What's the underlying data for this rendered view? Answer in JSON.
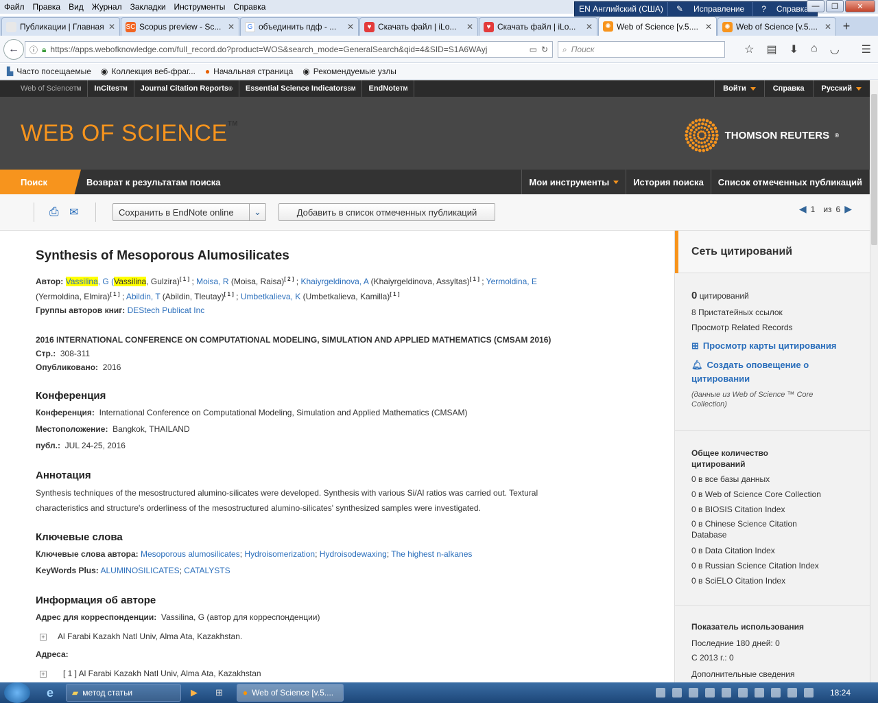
{
  "menubar": [
    "Файл",
    "Правка",
    "Вид",
    "Журнал",
    "Закладки",
    "Инструменты",
    "Справка"
  ],
  "lang_tray": {
    "lang": "EN Английский (США)",
    "correction": "Исправление",
    "help": "Справка"
  },
  "tabs": [
    {
      "label": "Публикации | Главная",
      "color": "#e8e8e8"
    },
    {
      "label": "Scopus preview - Sc...",
      "color": "#f26522",
      "glyph": "SC"
    },
    {
      "label": "объединить пдф - ...",
      "color": "#ffffff",
      "glyph": "G"
    },
    {
      "label": "Скачать файл | iLo...",
      "color": "#e33b3b",
      "glyph": "♥"
    },
    {
      "label": "Скачать файл | iLo...",
      "color": "#e33b3b",
      "glyph": "♥"
    },
    {
      "label": "Web of Science [v.5....",
      "color": "#f7941d",
      "glyph": "✺",
      "active": true
    },
    {
      "label": "Web of Science [v.5....",
      "color": "#f7941d",
      "glyph": "✺"
    }
  ],
  "url": "https://apps.webofknowledge.com/full_record.do?product=WOS&search_mode=GeneralSearch&qid=4&SID=S1A6WAyj",
  "search_placeholder": "Поиск",
  "bookmarks": [
    "Часто посещаемые",
    "Коллекция веб-фраг...",
    "Начальная страница",
    "Рекомендуемые узлы"
  ],
  "wos_top": {
    "wos": "Web of Science",
    "incites": "InCites",
    "jcr": "Journal Citation Reports",
    "esi": "Essential Science Indicators",
    "endnote": "EndNote",
    "login": "Войти",
    "help": "Справка",
    "lang": "Русский"
  },
  "logo": {
    "text": "WEB OF SCIENCE",
    "tr": "THOMSON REUTERS"
  },
  "nav": {
    "search": "Поиск",
    "back": "Возврат к результатам поиска",
    "tools": "Мои инструменты",
    "history": "История поиска",
    "marked": "Список отмеченных публикаций"
  },
  "toolbar": {
    "save": "Сохранить в EndNote online",
    "add": "Добавить в список отмеченных публикаций",
    "page": "1",
    "of": "из",
    "total": "6"
  },
  "record": {
    "title": "Synthesis of Mesoporous Alumosilicates",
    "author_label": "Автор:",
    "authors_line1_pre": "Vassilina",
    "a1_short": ", G (",
    "a1_hl": "Vassilina",
    "a1_rest": ", Gulzira)",
    "a1_ref": "[ 1 ]",
    "a2": "Moisa, R",
    "a2_full": "(Moisa, Raisa)",
    "a2_ref": "[ 2 ]",
    "a3": "Khaiyrgeldinova, A",
    "a3_full": "(Khaiyrgeldinova, Assyltas)",
    "a3_ref": "[ 1 ]",
    "a4": "Yermoldina, E",
    "a4_full": "(Yermoldina, Elmira)",
    "a4_ref": "[ 1 ]",
    "a5": "Abildin, T",
    "a5_full": "(Abildin, Tleutay)",
    "a5_ref": "[ 1 ]",
    "a6": "Umbetkalieva, K",
    "a6_full": "(Umbetkalieva, Kamilla)",
    "a6_ref": "[ 1 ]",
    "group_label": "Группы авторов книг:",
    "group": "DEStech Publicat Inc",
    "source": "2016 INTERNATIONAL CONFERENCE ON COMPUTATIONAL MODELING, SIMULATION AND APPLIED MATHEMATICS (CMSAM 2016)",
    "pages_label": "Стр.:",
    "pages": "308-311",
    "pub_label": "Опубликовано:",
    "pub": "2016",
    "conf_h": "Конференция",
    "conf_label": "Конференция:",
    "conf": "International Conference on Computational Modeling, Simulation and Applied Mathematics (CMSAM)",
    "loc_label": "Местоположение:",
    "loc": "Bangkok, THAILAND",
    "date_label": "публ.:",
    "date": "JUL 24-25, 2016",
    "abs_h": "Аннотация",
    "abs1": "Synthesis techniques of the mesostructured alumino-silicates were developed. Synthesis with various Si/Al ratios was carried out. Textural",
    "abs2": "characteristics and structure's orderliness of the mesostructured alumino-silicates' synthesized samples were investigated.",
    "kw_h": "Ключевые слова",
    "kw_label": "Ключевые слова автора:",
    "kw1": "Mesoporous alumosilicates",
    "kw2": "Hydroisomerization",
    "kw3": "Hydroisodewaxing",
    "kw4": "The highest n-alkanes",
    "kwp_label": "KeyWords Plus:",
    "kwp1": "ALUMINOSILICATES",
    "kwp2": "CATALYSTS",
    "ai_h": "Информация об авторе",
    "corr_label": "Адрес для корреспонденции:",
    "corr": "Vassilina, G (автор для корреспонденции)",
    "corr_addr": "Al Farabi Kazakh Natl Univ, Alma Ata, Kazakhstan.",
    "addr_label": "Адреса:",
    "addr1": "[ 1 ] Al Farabi Kazakh Natl Univ, Alma Ata, Kazakhstan"
  },
  "sidebar": {
    "net_h": "Сеть цитирований",
    "cit_count": "0",
    "cit_label": "цитирований",
    "refs": "8 Пристатейных ссылок",
    "related": "Просмотр Related Records",
    "map": "Просмотр карты цитирования",
    "alert1": "Создать оповещение о",
    "alert2": "цитировании",
    "note1": "(данные из Web of Science ™ Core",
    "note2": "Collection)",
    "total_h1": "Общее количество",
    "total_h2": "цитирований",
    "t1": "0 в все базы данных",
    "t2": "0 в Web of Science Core Collection",
    "t3": "0 в BIOSIS Citation Index",
    "t4a": "0 в Chinese Science Citation",
    "t4b": "Database",
    "t5": "0 в Data Citation Index",
    "t6": "0 в Russian Science Citation Index",
    "t7": "0 в SciELO Citation Index",
    "usage_h": "Показатель использования",
    "u1": "Последние 180 дней: 0",
    "u2": "С 2013 г.: 0",
    "more": "Дополнительные сведения"
  },
  "taskbar": {
    "item1": "метод статьи",
    "item2": "Web of Science [v.5....",
    "time": "18:24"
  }
}
